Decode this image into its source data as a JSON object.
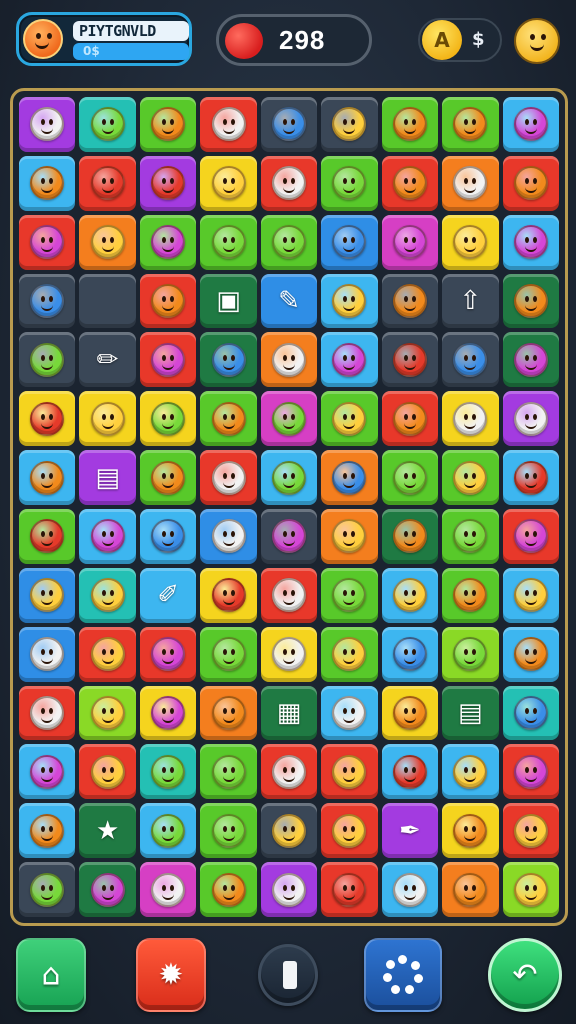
{
  "player": {
    "name": "PIYTGNVLD",
    "sub_label": "0$"
  },
  "score": {
    "value": "298",
    "icon": "red-apple-icon"
  },
  "coins": {
    "icon_glyph": "A",
    "value": "$",
    "icon": "gold-coin-icon"
  },
  "profile_icon": "smiley-face-icon",
  "board": {
    "columns": 9,
    "rows": 13,
    "tile_colors": {
      "purple": "#a33be0",
      "teal": "#24c0b4",
      "green": "#58c92a",
      "red": "#e8382a",
      "blue": "#2f8ee6",
      "darkgreen": "#1f7a43",
      "yellow": "#f5d41e",
      "orange": "#f47e1e",
      "pink": "#d63fc4",
      "lime": "#8ad926",
      "cyan": "#3db6f0",
      "gray": "#3a4757"
    },
    "tiles": [
      [
        "purple",
        "teal",
        "green",
        "red",
        "gray",
        "gray",
        "green",
        "green",
        "cyan"
      ],
      [
        "cyan",
        "red",
        "purple",
        "yellow",
        "red",
        "green",
        "red",
        "orange",
        "red"
      ],
      [
        "red",
        "orange",
        "green",
        "green",
        "green",
        "blue",
        "pink",
        "yellow",
        "cyan"
      ],
      [
        "gray",
        "gray",
        "red",
        "darkgreen",
        "blue",
        "cyan",
        "gray",
        "gray",
        "darkgreen"
      ],
      [
        "gray",
        "gray",
        "red",
        "darkgreen",
        "orange",
        "cyan",
        "gray",
        "gray",
        "darkgreen"
      ],
      [
        "yellow",
        "yellow",
        "yellow",
        "green",
        "pink",
        "green",
        "red",
        "yellow",
        "purple"
      ],
      [
        "cyan",
        "purple",
        "green",
        "red",
        "cyan",
        "orange",
        "green",
        "green",
        "cyan"
      ],
      [
        "green",
        "cyan",
        "cyan",
        "blue",
        "gray",
        "orange",
        "darkgreen",
        "green",
        "red"
      ],
      [
        "blue",
        "teal",
        "cyan",
        "yellow",
        "red",
        "green",
        "cyan",
        "green",
        "cyan"
      ],
      [
        "blue",
        "red",
        "red",
        "green",
        "yellow",
        "green",
        "cyan",
        "lime",
        "cyan"
      ],
      [
        "red",
        "lime",
        "yellow",
        "orange",
        "darkgreen",
        "cyan",
        "yellow",
        "darkgreen",
        "teal"
      ],
      [
        "cyan",
        "red",
        "teal",
        "green",
        "red",
        "red",
        "cyan",
        "cyan",
        "red"
      ],
      [
        "cyan",
        "darkgreen",
        "cyan",
        "green",
        "gray",
        "red",
        "purple",
        "yellow",
        "red"
      ],
      [
        "gray",
        "darkgreen",
        "pink",
        "green",
        "purple",
        "red",
        "cyan",
        "orange",
        "lime"
      ]
    ],
    "face_colors": {
      "f1": "#ffcf3d",
      "f2": "#f28a1c",
      "f3": "#78d93a",
      "f4": "#f2f2f2",
      "f5": "#d546d6",
      "f6": "#e53a2a",
      "f7": "#3a8ee8"
    },
    "pieces": [
      [
        "f4",
        "f3",
        "f2",
        "f4",
        "f7",
        "f1",
        "f2",
        "f2",
        "f5"
      ],
      [
        "f2",
        "f6",
        "f6",
        "f1",
        "f4",
        "f3",
        "f2",
        "f4",
        "f2"
      ],
      [
        "f5",
        "f1",
        "f5",
        "f3",
        "f3",
        "f7",
        "f5",
        "f1",
        "f5"
      ],
      [
        "f7",
        "",
        "f2",
        "box",
        "pencil",
        "f1",
        "f2",
        "arrow",
        "f2"
      ],
      [
        "f3",
        "pen",
        "f5",
        "f7",
        "f4",
        "f5",
        "f6",
        "f7",
        "f5"
      ],
      [
        "f6",
        "f1",
        "f3",
        "f2",
        "f3",
        "f1",
        "f2",
        "f4",
        "f4"
      ],
      [
        "f2",
        "gift",
        "f2",
        "f4",
        "f3",
        "f7",
        "f3",
        "f1",
        "f6"
      ],
      [
        "f6",
        "f5",
        "f7",
        "f4",
        "f5",
        "f1",
        "f2",
        "f3",
        "f5"
      ],
      [
        "f1",
        "f1",
        "brush",
        "f6",
        "f4",
        "f3",
        "f1",
        "f2",
        "f1"
      ],
      [
        "f4",
        "f1",
        "f5",
        "f3",
        "f4",
        "f1",
        "f7",
        "f3",
        "f2"
      ],
      [
        "f4",
        "f1",
        "f5",
        "f2",
        "cash",
        "f4",
        "f2",
        "gift",
        "f7"
      ],
      [
        "f5",
        "f1",
        "f3",
        "f3",
        "f4",
        "f1",
        "f6",
        "f1",
        "f5"
      ],
      [
        "f2",
        "star",
        "f3",
        "f3",
        "f1",
        "f1",
        "paint",
        "f2",
        "f1"
      ],
      [
        "f3",
        "f5",
        "f4",
        "f2",
        "f4",
        "f6",
        "f4",
        "f2",
        "f1"
      ]
    ]
  },
  "bottom_bar": {
    "home_icon": "home-icon",
    "booster_icon": "bomb-booster-icon",
    "pause_icon": "pause-icon",
    "shuffle_icon": "shuffle-icon",
    "undo_icon": "undo-icon"
  }
}
